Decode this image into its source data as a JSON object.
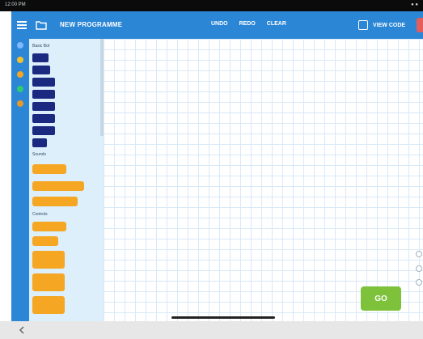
{
  "topbar": {
    "title": "NEW PROGRAMME",
    "actions": [
      "UNDO",
      "REDO",
      "CLEAR"
    ],
    "view_code_label": "VIEW CODE"
  },
  "palette": {
    "categories": [
      "Basic Bot",
      "Sounds",
      "Controls"
    ]
  },
  "canvas": {
    "go_label": "GO"
  },
  "colors": {
    "topbar": "#2b86d6",
    "palette_bg": "#ddeffb",
    "block_navy": "#1b2a80",
    "block_orange": "#f5a623",
    "go_button": "#7dc23a"
  },
  "icons": [
    "menu-icon",
    "folder-icon",
    "view-code-icon",
    "back-arrow-icon"
  ]
}
